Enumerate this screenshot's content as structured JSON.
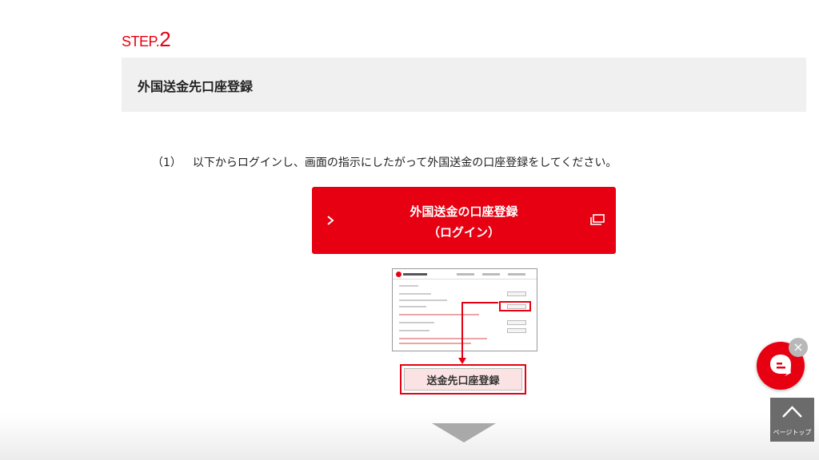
{
  "step": {
    "prefix": "STEP.",
    "number": "2"
  },
  "section": {
    "title": "外国送金先口座登録"
  },
  "instruction": {
    "number": "（1）",
    "text": "以下からログインし、画面の指示にしたがって外国送金の口座登録をしてください。"
  },
  "login_button": {
    "line1": "外国送金の口座登録",
    "line2": "（ログイン）",
    "chevron_icon": "chevron-right-icon",
    "external_icon": "external-window-icon"
  },
  "illustration": {
    "highlight_label": "送金先口座登録"
  },
  "page_top": {
    "label": "ページトップ",
    "icon": "chevron-up-icon"
  },
  "chat": {
    "icon": "chat-bubble-icon",
    "close_label": "×"
  },
  "colors": {
    "accent": "#e60012",
    "header_bg": "#f0f0f0",
    "page_top_bg": "#6b6b6b"
  }
}
